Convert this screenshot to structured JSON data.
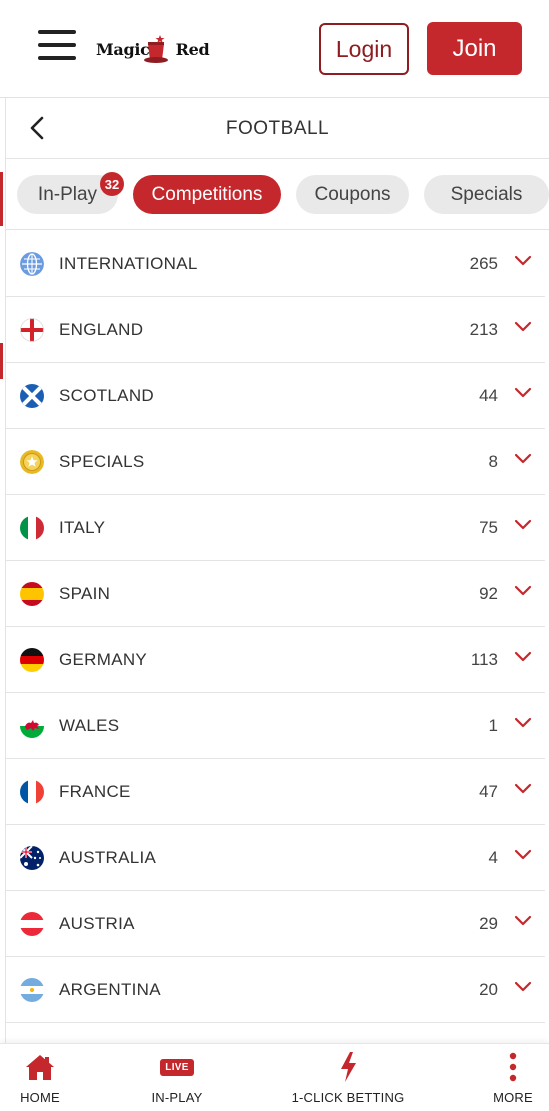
{
  "header": {
    "logo_left": "Magic",
    "logo_right": "Red",
    "login_label": "Login",
    "join_label": "Join"
  },
  "titlebar": {
    "title": "FOOTBALL"
  },
  "tabs": {
    "items": [
      {
        "label": "In-Play",
        "active": false
      },
      {
        "label": "Competitions",
        "active": true
      },
      {
        "label": "Coupons",
        "active": false
      },
      {
        "label": "Specials",
        "active": false
      }
    ],
    "inplay_badge": "32"
  },
  "competitions": [
    {
      "label": "INTERNATIONAL",
      "count": "265",
      "icon": "globe-icon"
    },
    {
      "label": "ENGLAND",
      "count": "213",
      "icon": "flag-england-icon"
    },
    {
      "label": "SCOTLAND",
      "count": "44",
      "icon": "flag-scotland-icon"
    },
    {
      "label": "SPECIALS",
      "count": "8",
      "icon": "star-coin-icon"
    },
    {
      "label": "ITALY",
      "count": "75",
      "icon": "flag-italy-icon"
    },
    {
      "label": "SPAIN",
      "count": "92",
      "icon": "flag-spain-icon"
    },
    {
      "label": "GERMANY",
      "count": "113",
      "icon": "flag-germany-icon"
    },
    {
      "label": "WALES",
      "count": "1",
      "icon": "flag-wales-icon"
    },
    {
      "label": "FRANCE",
      "count": "47",
      "icon": "flag-france-icon"
    },
    {
      "label": "AUSTRALIA",
      "count": "4",
      "icon": "flag-australia-icon"
    },
    {
      "label": "AUSTRIA",
      "count": "29",
      "icon": "flag-austria-icon"
    },
    {
      "label": "ARGENTINA",
      "count": "20",
      "icon": "flag-argentina-icon"
    }
  ],
  "bottom_nav": {
    "home": "HOME",
    "inplay": "IN-PLAY",
    "live_badge": "LIVE",
    "oneclick": "1-CLICK BETTING",
    "more": "MORE"
  },
  "colors": {
    "brand_red": "#c5282c",
    "login_border": "#8e1c20",
    "tab_inactive": "#e9e9e9"
  }
}
